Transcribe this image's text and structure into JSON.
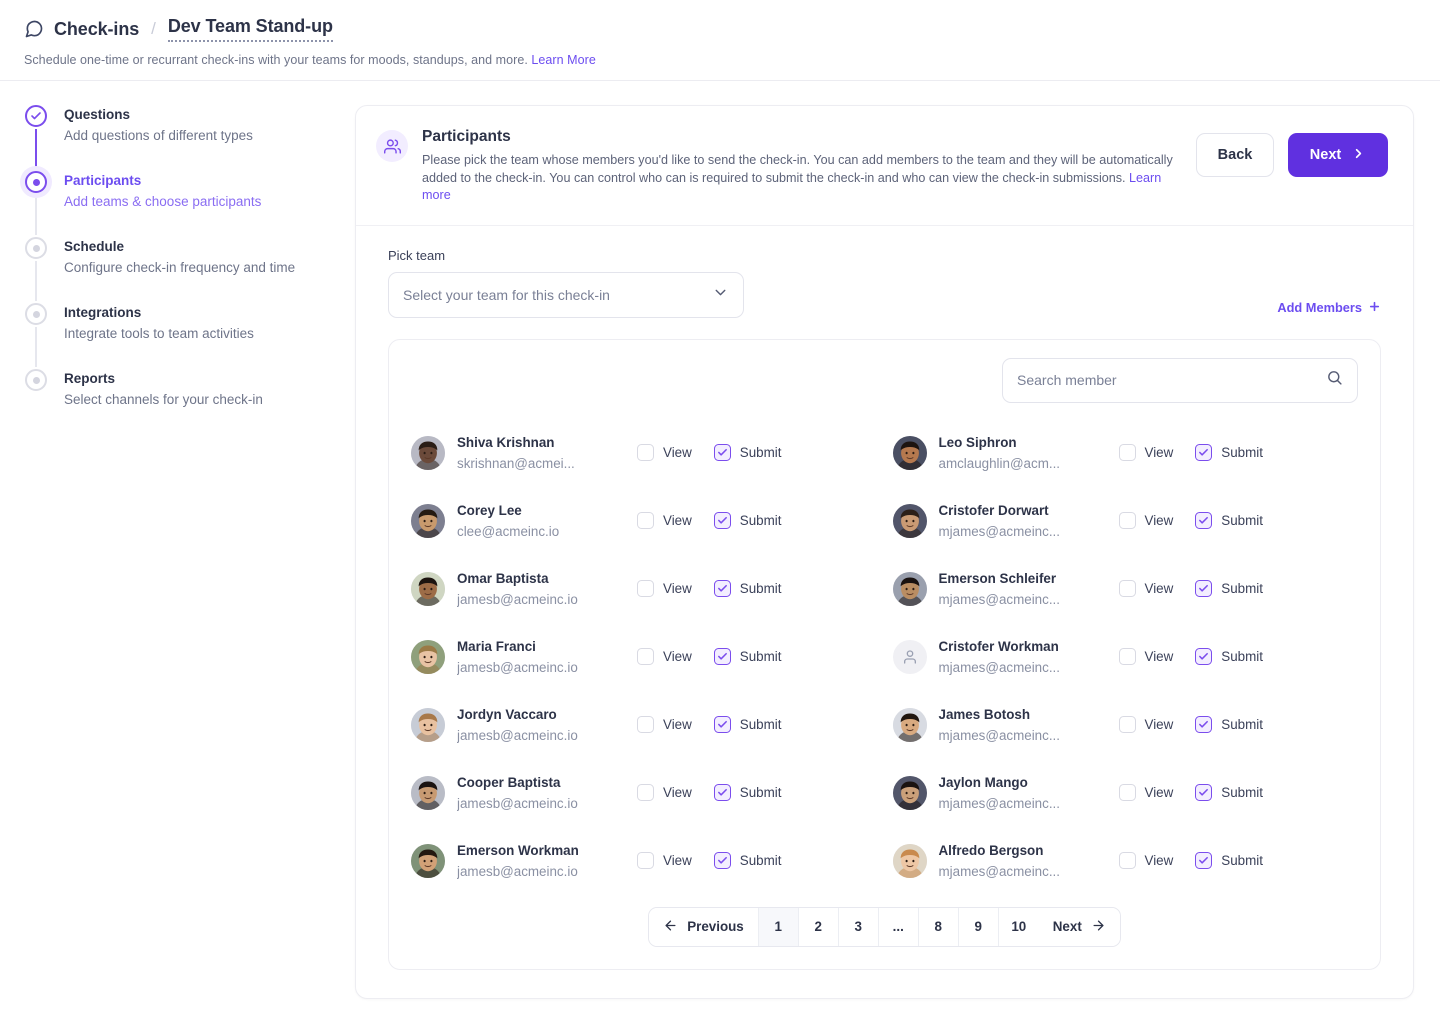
{
  "header": {
    "icon": "chat-bubble-icon",
    "breadcrumb_root": "Check-ins",
    "breadcrumb_separator": "/",
    "breadcrumb_current": "Dev Team Stand-up",
    "subtitle": "Schedule one-time or recurrant check-ins with your teams for moods, standups, and more.",
    "subtitle_link": "Learn More"
  },
  "stepper": {
    "steps": [
      {
        "title": "Questions",
        "desc": "Add questions of different types",
        "state": "done"
      },
      {
        "title": "Participants",
        "desc": "Add teams & choose participants",
        "state": "active"
      },
      {
        "title": "Schedule",
        "desc": "Configure check-in frequency and time",
        "state": "todo"
      },
      {
        "title": "Integrations",
        "desc": "Integrate tools to team activities",
        "state": "todo"
      },
      {
        "title": "Reports",
        "desc": "Select channels for your check-in",
        "state": "todo"
      }
    ]
  },
  "panel": {
    "icon": "participants-icon",
    "title": "Participants",
    "description": "Please pick the team whose members you'd like to send the check-in. You can add members to the team and they will be automatically added to the check-in. You can control who can is required to submit the check-in and who can view the check-in submissions.",
    "description_link": "Learn more",
    "back_label": "Back",
    "next_label": "Next"
  },
  "pick_team": {
    "label": "Pick team",
    "selected_value": "Select your team for this check-in",
    "add_members_label": "Add Members"
  },
  "search": {
    "placeholder": "Search member",
    "value": ""
  },
  "permissions": {
    "view_label": "View",
    "submit_label": "Submit"
  },
  "members": [
    {
      "name": "Shiva Krishnan",
      "email": "skrishnan@acmei...",
      "view": false,
      "submit": true,
      "avatar": "photo",
      "tone": "#6b4a3a",
      "hair": "#2a1d16",
      "bg": "#b8b9c4"
    },
    {
      "name": "Leo Siphron",
      "email": "amclaughlin@acm...",
      "view": false,
      "submit": true,
      "avatar": "photo",
      "tone": "#b5794f",
      "hair": "#1d1410",
      "bg": "#4a4f63"
    },
    {
      "name": "Corey Lee",
      "email": "clee@acmeinc.io",
      "view": false,
      "submit": true,
      "avatar": "photo",
      "tone": "#c89a6d",
      "hair": "#241a12",
      "bg": "#7d7f90"
    },
    {
      "name": "Cristofer Dorwart",
      "email": "mjames@acmeinc...",
      "view": false,
      "submit": true,
      "avatar": "photo",
      "tone": "#c99a74",
      "hair": "#2b1f18",
      "bg": "#51556a"
    },
    {
      "name": "Omar Baptista",
      "email": "jamesb@acmeinc.io",
      "view": false,
      "submit": true,
      "avatar": "photo",
      "tone": "#9d6c47",
      "hair": "#1c1410",
      "bg": "#cfd6c2"
    },
    {
      "name": "Emerson Schleifer",
      "email": "mjames@acmeinc...",
      "view": false,
      "submit": true,
      "avatar": "photo",
      "tone": "#b98d62",
      "hair": "#191210",
      "bg": "#9aa0ae"
    },
    {
      "name": "Maria Franci",
      "email": "jamesb@acmeinc.io",
      "view": false,
      "submit": true,
      "avatar": "photo",
      "tone": "#e8c3a4",
      "hair": "#9b7a46",
      "bg": "#8fa07c"
    },
    {
      "name": "Cristofer Workman",
      "email": "mjames@acmeinc...",
      "view": false,
      "submit": true,
      "avatar": "placeholder",
      "tone": "",
      "hair": "",
      "bg": "#f0f0f4"
    },
    {
      "name": "Jordyn Vaccaro",
      "email": "jamesb@acmeinc.io",
      "view": false,
      "submit": true,
      "avatar": "photo",
      "tone": "#e8c1a0",
      "hair": "#a8794a",
      "bg": "#c7ccd6"
    },
    {
      "name": "James Botosh",
      "email": "mjames@acmeinc...",
      "view": false,
      "submit": true,
      "avatar": "photo",
      "tone": "#d8aa80",
      "hair": "#20160f",
      "bg": "#d8dbe2"
    },
    {
      "name": "Cooper Baptista",
      "email": "jamesb@acmeinc.io",
      "view": false,
      "submit": true,
      "avatar": "photo",
      "tone": "#c79a72",
      "hair": "#191210",
      "bg": "#b9bcc6"
    },
    {
      "name": "Jaylon Mango",
      "email": "mjames@acmeinc...",
      "view": false,
      "submit": true,
      "avatar": "photo",
      "tone": "#caa07a",
      "hair": "#1a1310",
      "bg": "#52566a"
    },
    {
      "name": "Emerson Workman",
      "email": "jamesb@acmeinc.io",
      "view": false,
      "submit": true,
      "avatar": "photo",
      "tone": "#d2a177",
      "hair": "#241810",
      "bg": "#7f9278"
    },
    {
      "name": "Alfredo Bergson",
      "email": "mjames@acmeinc...",
      "view": false,
      "submit": true,
      "avatar": "photo",
      "tone": "#eec7a5",
      "hair": "#c98a4e",
      "bg": "#dfd6c6"
    }
  ],
  "pagination": {
    "previous_label": "Previous",
    "next_label": "Next",
    "pages": [
      "1",
      "2",
      "3",
      "...",
      "8",
      "9",
      "10"
    ],
    "active_page": "1"
  },
  "colors": {
    "accent": "#6c4df0",
    "next_button": "#6030e0",
    "step_active": "#7b4ded",
    "text_primary": "#2d3348",
    "text_muted": "#6e7489"
  }
}
